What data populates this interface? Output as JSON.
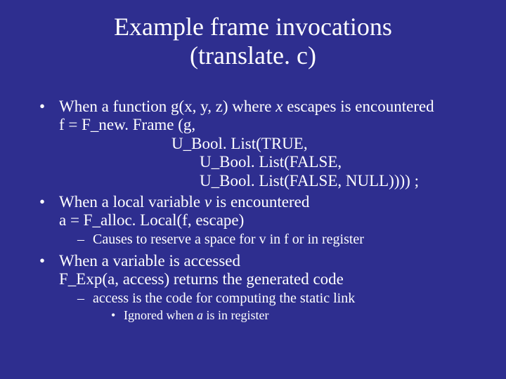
{
  "title_line1": "Example frame invocations",
  "title_line2": "(translate. c)",
  "b1": {
    "p1a": "When a function g(x, y, z) where ",
    "p1b_it": "x",
    "p1c": " escapes is encountered",
    "l2": "f = F_new. Frame (g,",
    "l3": "U_Bool. List(TRUE,",
    "l4": "U_Bool. List(FALSE,",
    "l5": "U_Bool. List(FALSE, NULL)))) ;"
  },
  "b2": {
    "p1a": "When a local variable ",
    "p1b_it": "v",
    "p1c": " is encountered",
    "l2": "a = F_alloc. Local(f, escape)",
    "sub1": "Causes to reserve a space for v in f or in register"
  },
  "b3": {
    "l1": "When a variable is accessed",
    "l2": "F_Exp(a, access) returns the generated code",
    "sub1": "access is the code for computing the static link",
    "sub2a": "Ignored when ",
    "sub2b_it": "a",
    "sub2c": " is in register"
  }
}
